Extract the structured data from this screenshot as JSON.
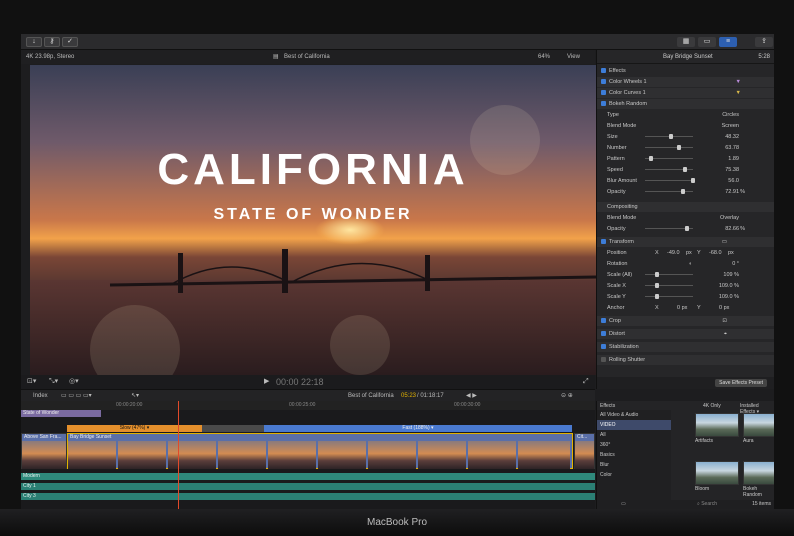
{
  "device": {
    "label": "MacBook Pro"
  },
  "toolbar": {
    "import_icon": "download-icon",
    "keyword_icon": "key-icon",
    "check_icon": "checkmark-icon",
    "share_icon": "share-icon"
  },
  "viewer": {
    "format": "4K 23.98p, Stereo",
    "project": "Best of California",
    "zoom": "64%",
    "view_menu": "View",
    "title": "CALIFORNIA",
    "subtitle": "STATE OF WONDER",
    "timecode": "00:00 22:18"
  },
  "inspector": {
    "clip_name": "Bay Bridge Sunset",
    "duration": "5:28",
    "sections": {
      "effects": "Effects",
      "compositing": "Compositing",
      "transform": "Transform",
      "crop": "Crop",
      "distort": "Distort",
      "stabilization": "Stabilization",
      "rolling_shutter": "Rolling Shutter"
    },
    "effects_items": [
      "Color Wheels 1",
      "Color Curves 1",
      "Bokeh Random"
    ],
    "bokeh": {
      "type_label": "Type",
      "type_value": "Circles",
      "blend_label": "Blend Mode",
      "blend_value": "Screen",
      "size_label": "Size",
      "size_value": "48.32",
      "number_label": "Number",
      "number_value": "63.78",
      "pattern_label": "Pattern",
      "pattern_value": "1.89",
      "speed_label": "Speed",
      "speed_value": "75.38",
      "blur_label": "Blur Amount",
      "blur_value": "56.0",
      "opacity_label": "Opacity",
      "opacity_value": "72.91",
      "opacity_unit": "%"
    },
    "compositing": {
      "blend_label": "Blend Mode",
      "blend_value": "Overlay",
      "opacity_label": "Opacity",
      "opacity_value": "82.66",
      "opacity_unit": "%"
    },
    "transform": {
      "position_label": "Position",
      "x_label": "X",
      "pos_x": "-49.0",
      "pos_x_unit": "px",
      "y_label": "Y",
      "pos_y": "-68.0",
      "pos_y_unit": "px",
      "rotation_label": "Rotation",
      "rotation_value": "0 °",
      "scale_all_label": "Scale (All)",
      "scale_all_value": "109 %",
      "scale_x_label": "Scale X",
      "scale_x_value": "109.0 %",
      "scale_y_label": "Scale Y",
      "scale_y_value": "109.0 %",
      "anchor_label": "Anchor",
      "anchor_x": "0 px",
      "anchor_y": "0 px"
    },
    "save_button": "Save Effects Preset"
  },
  "timeline": {
    "index_label": "Index",
    "project": "Best of California",
    "position": "05:23",
    "total": "/ 01:18:17",
    "ruler": [
      "00:00:20:00",
      "00:00:25:00",
      "00:00:30:00"
    ],
    "title_clip": "State of Wonder",
    "retime_slow": "Slow (47%) ▾",
    "retime_fast": "Fast (188%) ▾",
    "clip_left": "Above San Fra...",
    "clip_main": "Bay Bridge Sunset",
    "clip_right": "Cit...",
    "audio_tracks": [
      "Modern",
      "City 1",
      "City 3"
    ]
  },
  "browser": {
    "title": "Effects",
    "tab_4k": "4K Only",
    "tab_installed": "Installed Effects ▾",
    "categories": [
      "All Video & Audio",
      "VIDEO",
      "All",
      "360°",
      "Basics",
      "Blur",
      "Color"
    ],
    "thumbs": [
      "Artifacts",
      "Aura",
      "Bloom",
      "Bokeh Random"
    ],
    "search_placeholder": "Search",
    "count": "15 items"
  }
}
